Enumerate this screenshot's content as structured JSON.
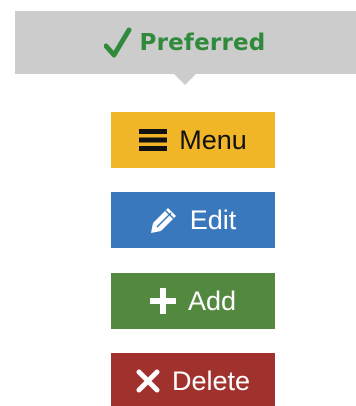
{
  "banner": {
    "label": "Preferred",
    "icon": "check-icon",
    "color": "#2f8a3c",
    "background": "#cccccc"
  },
  "buttons": [
    {
      "label": "Menu",
      "icon": "hamburger-icon",
      "background": "#f1b627",
      "text_color": "#111111"
    },
    {
      "label": "Edit",
      "icon": "pencil-icon",
      "background": "#3a78bd",
      "text_color": "#ffffff"
    },
    {
      "label": "Add",
      "icon": "plus-icon",
      "background": "#53883f",
      "text_color": "#ffffff"
    },
    {
      "label": "Delete",
      "icon": "x-icon",
      "background": "#a0312d",
      "text_color": "#ffffff"
    }
  ]
}
